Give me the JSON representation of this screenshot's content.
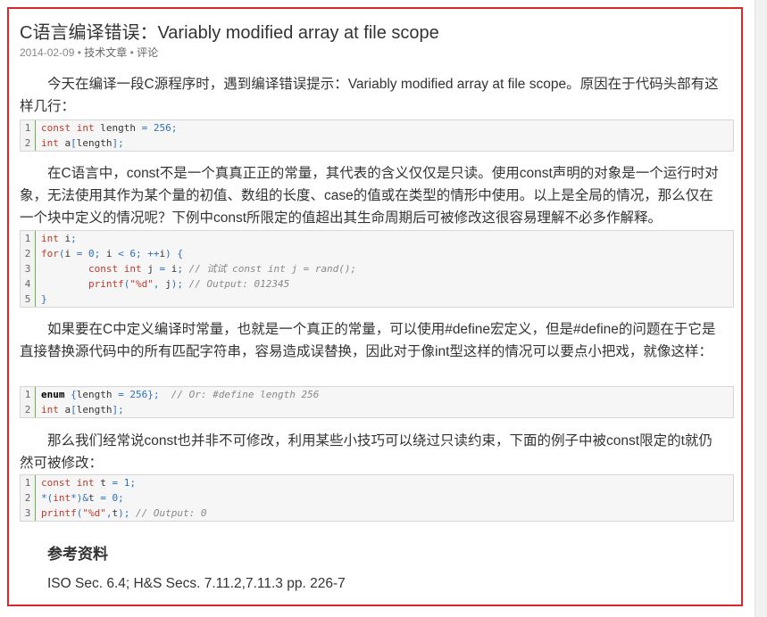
{
  "article": {
    "title": "C语言编译错误：Variably modified array at file scope",
    "meta": {
      "date": "2014-02-09",
      "separator": " • ",
      "category": "技术文章",
      "comment": "评论"
    },
    "paragraphs": [
      "今天在编译一段C源程序时，遇到编译错误提示：Variably modified array at file scope。原因在于代码头部有这样几行：",
      "在C语言中，const不是一个真真正正的常量，其代表的含义仅仅是只读。使用const声明的对象是一个运行时对象，无法使用其作为某个量的初值、数组的长度、case的值或在类型的情形中使用。以上是全局的情况，那么仅在一个块中定义的情况呢？下例中const所限定的值超出其生命周期后可被修改这很容易理解不必多作解释。",
      "如果要在C中定义编译时常量，也就是一个真正的常量，可以使用#define宏定义，但是#define的问题在于它是直接替换源代码中的所有匹配字符串，容易造成误替换，因此对于像int型这样的情况可以要点小把戏，就像这样：",
      "那么我们经常说const也并非不可修改，利用某些小技巧可以绕过只读约束，下面的例子中被const限定的t就仍然可被修改："
    ],
    "code_blocks": [
      {
        "lines": [
          {
            "num": "1",
            "text": "const int length = 256;"
          },
          {
            "num": "2",
            "text": "int a[length];"
          }
        ]
      },
      {
        "lines": [
          {
            "num": "1",
            "text": "int i;"
          },
          {
            "num": "2",
            "text": "for(i = 0; i < 6; ++i) {"
          },
          {
            "num": "3",
            "text": "        const int j = i; // 试试 const int j = rand();"
          },
          {
            "num": "4",
            "text": "        printf(\"%d\", j); // Output: 012345"
          },
          {
            "num": "5",
            "text": "}"
          }
        ]
      },
      {
        "lines": [
          {
            "num": "1",
            "text": "enum {length = 256};  // Or: #define length 256"
          },
          {
            "num": "2",
            "text": "int a[length];"
          }
        ]
      },
      {
        "lines": [
          {
            "num": "1",
            "text": "const int t = 1;"
          },
          {
            "num": "2",
            "text": "*(int*)&t = 0;"
          },
          {
            "num": "3",
            "text": "printf(\"%d\",t); // Output: 0"
          }
        ]
      }
    ],
    "references": {
      "heading": "参考资料",
      "items": [
        "ISO Sec. 6.4; H&S Secs. 7.11.2,7.11.3 pp. 226-7"
      ]
    }
  },
  "colors": {
    "frame_border": "#d9272b",
    "code_background": "#f6f6f6",
    "gutter_border": "#6ab04c",
    "keyword": "#c0392b",
    "number": "#2c6fbb",
    "comment": "#888888"
  }
}
